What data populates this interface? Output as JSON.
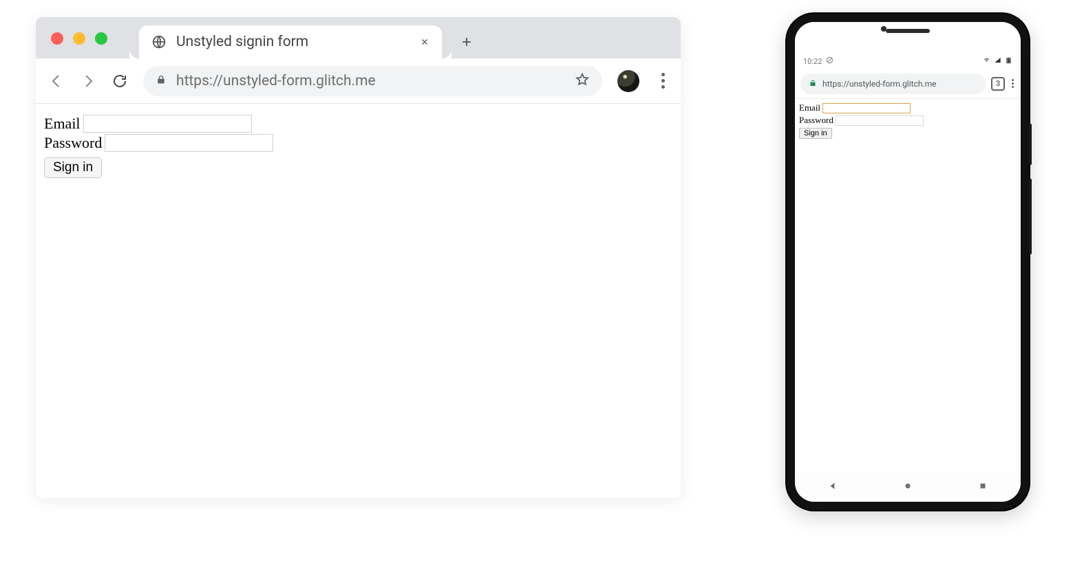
{
  "desktop": {
    "tab_title": "Unstyled signin form",
    "url": "https://unstyled-form.glitch.me",
    "form": {
      "email_label": "Email",
      "password_label": "Password",
      "signin_label": "Sign in"
    }
  },
  "phone": {
    "status": {
      "time": "10:22",
      "tab_count": "3"
    },
    "url": "https://unstyled-form.glitch.me",
    "form": {
      "email_label": "Email",
      "password_label": "Password",
      "signin_label": "Sign in"
    }
  }
}
